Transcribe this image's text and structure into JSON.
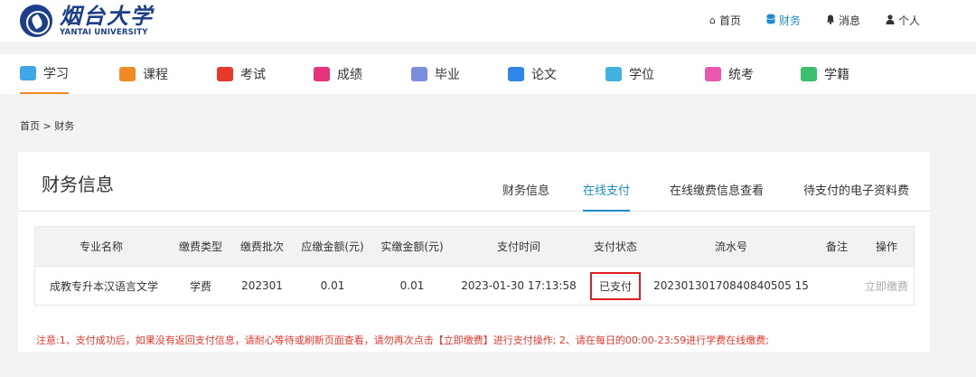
{
  "header": {
    "logo_cn": "烟台大学",
    "logo_en": "YANTAI UNIVERSITY",
    "nav": [
      {
        "label": "首页",
        "icon": "home-icon"
      },
      {
        "label": "财务",
        "icon": "database-icon",
        "active": true
      },
      {
        "label": "消息",
        "icon": "bell-icon"
      },
      {
        "label": "个人",
        "icon": "user-icon"
      }
    ]
  },
  "menu": [
    {
      "label": "学习",
      "icon": "study-icon",
      "color": "#3fa6e8",
      "active": true
    },
    {
      "label": "课程",
      "icon": "course-icon",
      "color": "#f08a24"
    },
    {
      "label": "考试",
      "icon": "exam-icon",
      "color": "#e8372b"
    },
    {
      "label": "成绩",
      "icon": "score-icon",
      "color": "#e8327c"
    },
    {
      "label": "毕业",
      "icon": "graduation-icon",
      "color": "#7a8ee0"
    },
    {
      "label": "论文",
      "icon": "thesis-icon",
      "color": "#2f86e8"
    },
    {
      "label": "学位",
      "icon": "degree-icon",
      "color": "#3fb2e0"
    },
    {
      "label": "统考",
      "icon": "unified-exam-icon",
      "color": "#e858b0"
    },
    {
      "label": "学籍",
      "icon": "student-status-icon",
      "color": "#3bbf6a"
    }
  ],
  "breadcrumb": "首页 > 财务",
  "panel": {
    "title": "财务信息",
    "tabs": [
      {
        "label": "财务信息"
      },
      {
        "label": "在线支付",
        "active": true
      },
      {
        "label": "在线缴费信息查看"
      },
      {
        "label": "待支付的电子资料费"
      }
    ]
  },
  "table": {
    "headers": [
      "专业名称",
      "缴费类型",
      "缴费批次",
      "应缴金额(元)",
      "实缴金额(元)",
      "支付时间",
      "支付状态",
      "流水号",
      "备注",
      "操作"
    ],
    "rows": [
      {
        "major": "成教专升本汉语言文学",
        "fee_type": "学费",
        "batch": "202301",
        "due": "0.01",
        "paid": "0.01",
        "pay_time": "2023-01-30 17:13:58",
        "status": "已支付",
        "serial": "20230130170840840505 15",
        "note": "",
        "action": "立即缴费"
      }
    ]
  },
  "notice": "注意:1、支付成功后，如果没有返回支付信息，请耐心等待或刷新页面查看，请勿再次点击【立即缴费】进行支付操作; 2、请在每日的00:00-23:59进行学费在线缴费;",
  "colors": {
    "accent": "#1b8cd0",
    "menu_active": "#f08a24",
    "warning": "#e8372b"
  }
}
